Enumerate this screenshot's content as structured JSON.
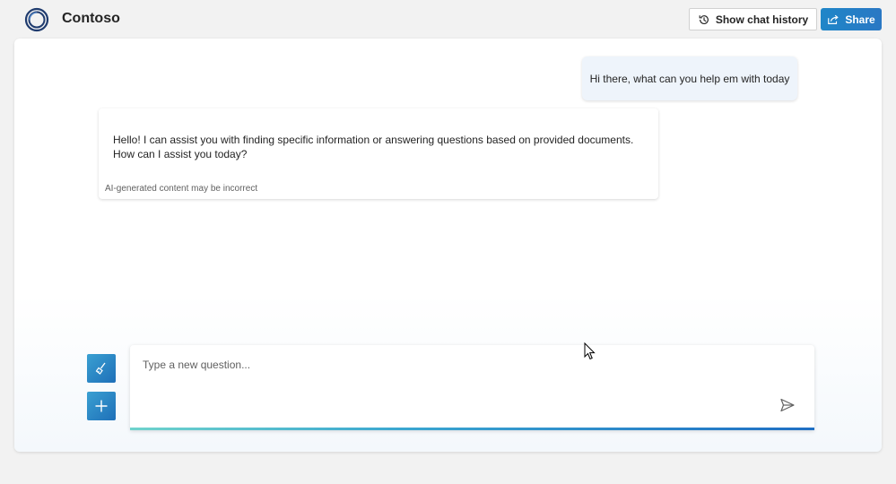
{
  "header": {
    "app_title": "Contoso",
    "history_button_label": "Show chat history",
    "share_button_label": "Share"
  },
  "icons": {
    "logo": "contoso-ring-logo",
    "history": "history-clock-icon",
    "share": "share-arrow-icon",
    "clear": "broom-icon",
    "new_chat": "plus-icon",
    "send": "send-icon",
    "cursor": "mouse-pointer-icon"
  },
  "colors": {
    "accent": "#1f86c8",
    "accent_dark": "#1f6fc4",
    "user_bubble": "#eef4fb",
    "page_bg": "#f2f2f2"
  },
  "chat": {
    "messages": [
      {
        "role": "user",
        "text": "Hi there, what can you help em with today"
      },
      {
        "role": "assistant",
        "text": "Hello! I can assist you with finding specific information or answering questions based on provided documents. How can I assist you today?",
        "disclaimer": "AI-generated content may be incorrect"
      }
    ]
  },
  "composer": {
    "placeholder": "Type a new question...",
    "value": ""
  }
}
